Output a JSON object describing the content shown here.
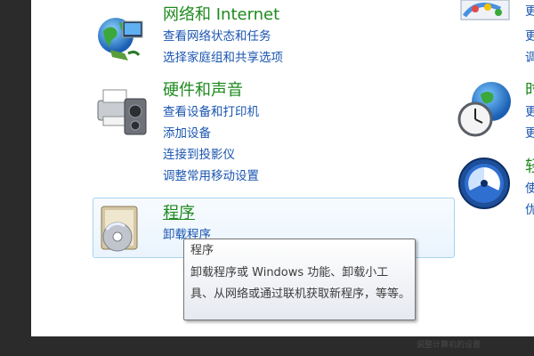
{
  "categories": {
    "network": {
      "title": "网络和 Internet",
      "links": [
        "查看网络状态和任务",
        "选择家庭组和共享选项"
      ]
    },
    "hardware": {
      "title": "硬件和声音",
      "links": [
        "查看设备和打印机",
        "添加设备",
        "连接到投影仪",
        "调整常用移动设置"
      ]
    },
    "programs": {
      "title": "程序",
      "links": [
        "卸载程序"
      ]
    }
  },
  "right_column": {
    "appearance_links": [
      "更",
      "更",
      "调"
    ],
    "clock": {
      "title": "时",
      "links": [
        "更",
        "更"
      ]
    },
    "ease": {
      "title": "轻",
      "links": [
        "使",
        "优"
      ]
    }
  },
  "tooltip": {
    "title": "程序",
    "body": "卸载程序或 Windows 功能、卸载小工具、从网络或通过联机获取新程序，等等。"
  },
  "footer": {
    "text": "调整计算机的设置"
  },
  "icons": {
    "network": "network-globe-icon",
    "hardware": "printer-speaker-icon",
    "programs": "programs-disc-icon",
    "appearance": "appearance-palette-icon",
    "clock": "clock-globe-icon",
    "ease": "ease-of-access-icon"
  },
  "colors": {
    "category_title": "#1e8a1e",
    "link": "#1a55b0",
    "hover_border": "#a8d3ef"
  }
}
